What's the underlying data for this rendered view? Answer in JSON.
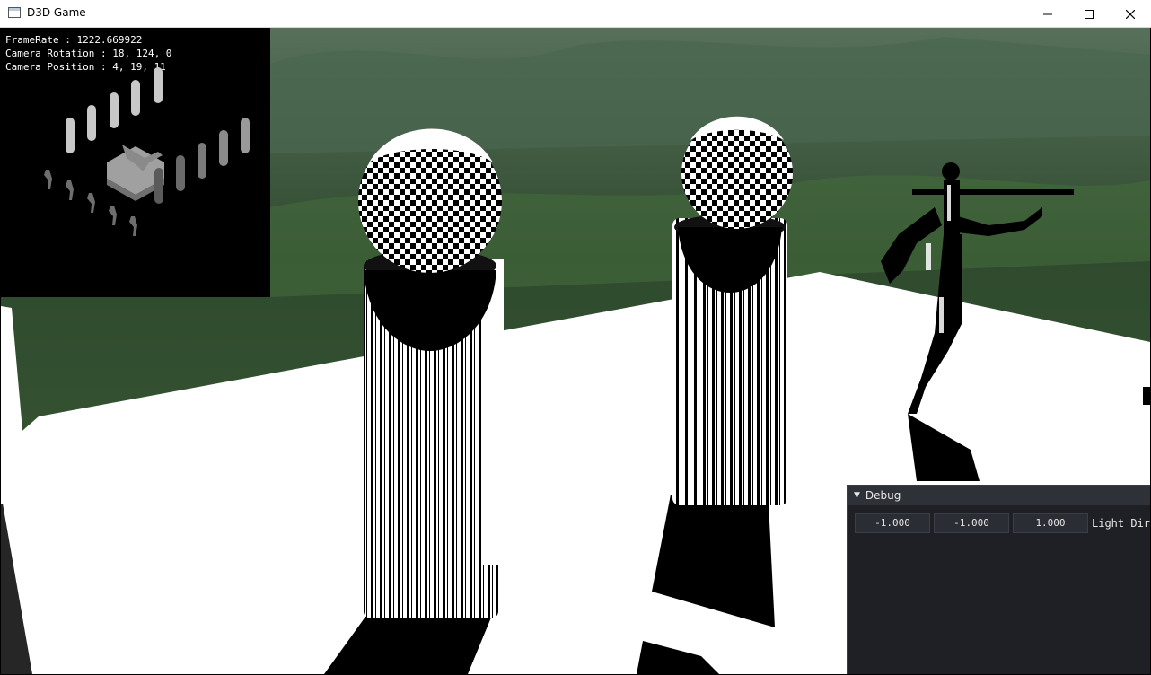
{
  "window": {
    "title": "D3D Game",
    "icon": "app-window-icon"
  },
  "stats": {
    "framerate": "FrameRate : 1222.669922",
    "rotation": "Camera Rotation : 18, 124, 0",
    "position": "Camera Position : 4, 19, 11"
  },
  "debug": {
    "title": "Debug",
    "light_dir": {
      "x": "-1.000",
      "y": "-1.000",
      "z": "1.000",
      "label": "Light Dir"
    }
  },
  "colors": {
    "terrain": "#3a5a3a",
    "panel_bg": "#1f2026",
    "panel_header": "#2e3238",
    "field_bg": "#2a2d34"
  }
}
